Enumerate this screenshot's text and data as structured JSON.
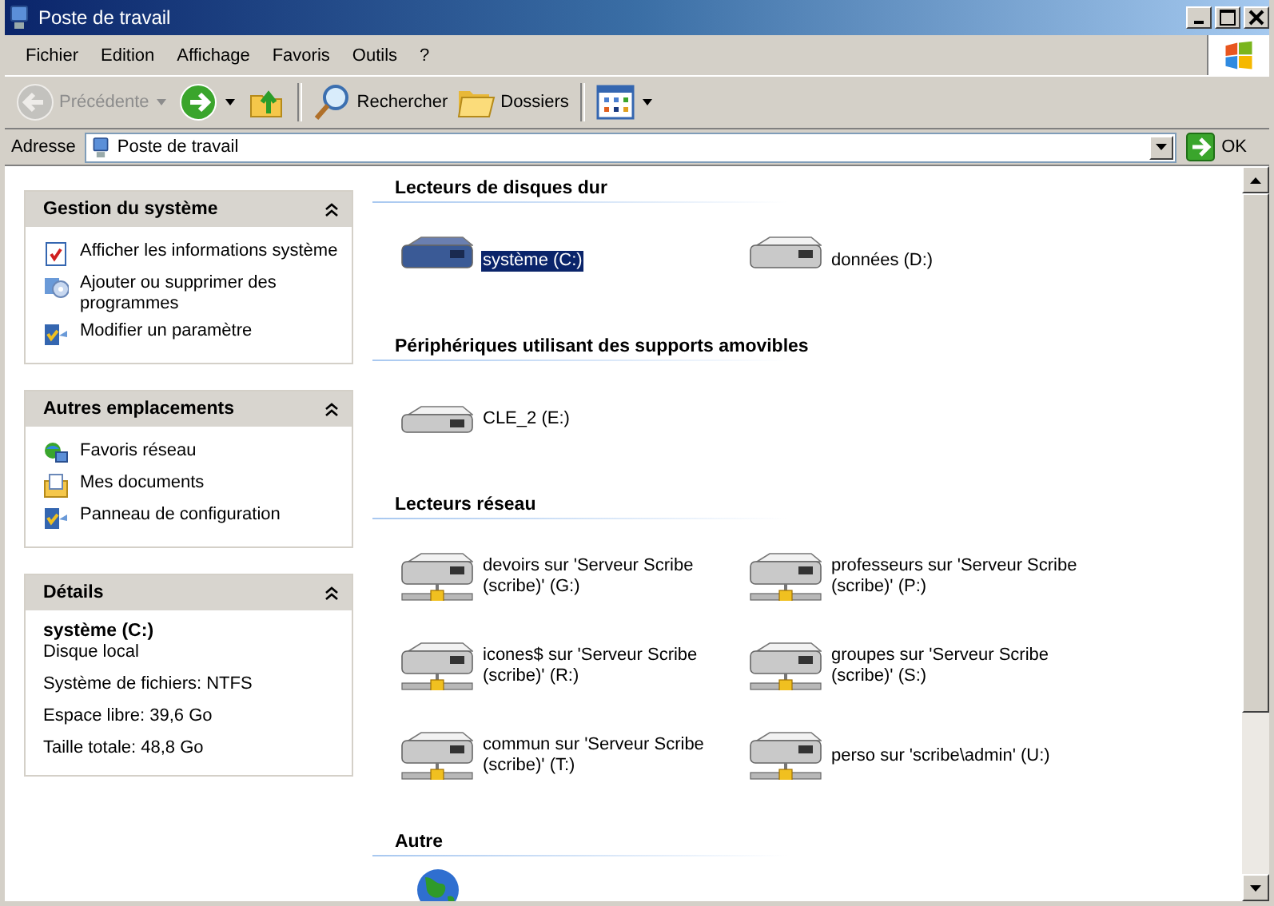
{
  "window": {
    "title": "Poste de travail"
  },
  "menu": [
    "Fichier",
    "Edition",
    "Affichage",
    "Favoris",
    "Outils",
    "?"
  ],
  "toolbar": [
    {
      "kind": "back",
      "label": "Précédente",
      "disabled": true
    },
    {
      "kind": "forward",
      "disabled": false
    },
    {
      "kind": "up",
      "disabled": false
    },
    {
      "kind": "separator"
    },
    {
      "kind": "search",
      "label": "Rechercher",
      "disabled": false
    },
    {
      "kind": "folders",
      "label": "Dossiers",
      "disabled": false
    },
    {
      "kind": "separator"
    },
    {
      "kind": "views",
      "disabled": false
    }
  ],
  "address": {
    "label": "Adresse",
    "value": "Poste de travail",
    "go": "OK"
  },
  "sidebar": [
    {
      "title": "Gestion du système",
      "expanded": true,
      "links": [
        {
          "kind": "info",
          "label": "Afficher les informations système"
        },
        {
          "kind": "programs",
          "label": "Ajouter ou supprimer des programmes"
        },
        {
          "kind": "settings",
          "label": "Modifier un paramètre"
        }
      ]
    },
    {
      "title": "Autres emplacements",
      "expanded": true,
      "links": [
        {
          "kind": "network",
          "label": "Favoris réseau"
        },
        {
          "kind": "documents",
          "label": "Mes documents"
        },
        {
          "kind": "settings",
          "label": "Panneau de configuration"
        }
      ]
    },
    {
      "title": "Détails",
      "expanded": true,
      "details": {
        "name": "système (C:)",
        "lines": [
          "Disque local",
          "Système de fichiers: NTFS",
          "Espace libre: 39,6 Go",
          "Taille totale: 48,8 Go"
        ]
      }
    }
  ],
  "sections": [
    {
      "title": "Lecteurs de disques dur",
      "items": [
        {
          "kind": "local",
          "label": "système (C:)",
          "selected": true
        },
        {
          "kind": "local",
          "label": "données (D:)",
          "selected": false
        }
      ]
    },
    {
      "title": "Périphériques utilisant des supports amovibles",
      "items": [
        {
          "kind": "removable",
          "label": "CLE_2 (E:)",
          "selected": false
        }
      ]
    },
    {
      "title": "Lecteurs réseau",
      "items": [
        {
          "kind": "network",
          "label": "devoirs sur 'Serveur Scribe (scribe)' (G:)",
          "selected": false
        },
        {
          "kind": "network",
          "label": "professeurs sur 'Serveur Scribe (scribe)' (P:)",
          "selected": false
        },
        {
          "kind": "network",
          "label": "icones$ sur 'Serveur Scribe (scribe)' (R:)",
          "selected": false
        },
        {
          "kind": "network",
          "label": "groupes sur 'Serveur Scribe (scribe)' (S:)",
          "selected": false
        },
        {
          "kind": "network",
          "label": "commun sur 'Serveur Scribe (scribe)' (T:)",
          "selected": false
        },
        {
          "kind": "network",
          "label": "perso sur 'scribe\\admin' (U:)",
          "selected": false
        }
      ]
    },
    {
      "title": "Autre",
      "items": [
        {
          "kind": "globe",
          "selected": false
        }
      ]
    }
  ]
}
